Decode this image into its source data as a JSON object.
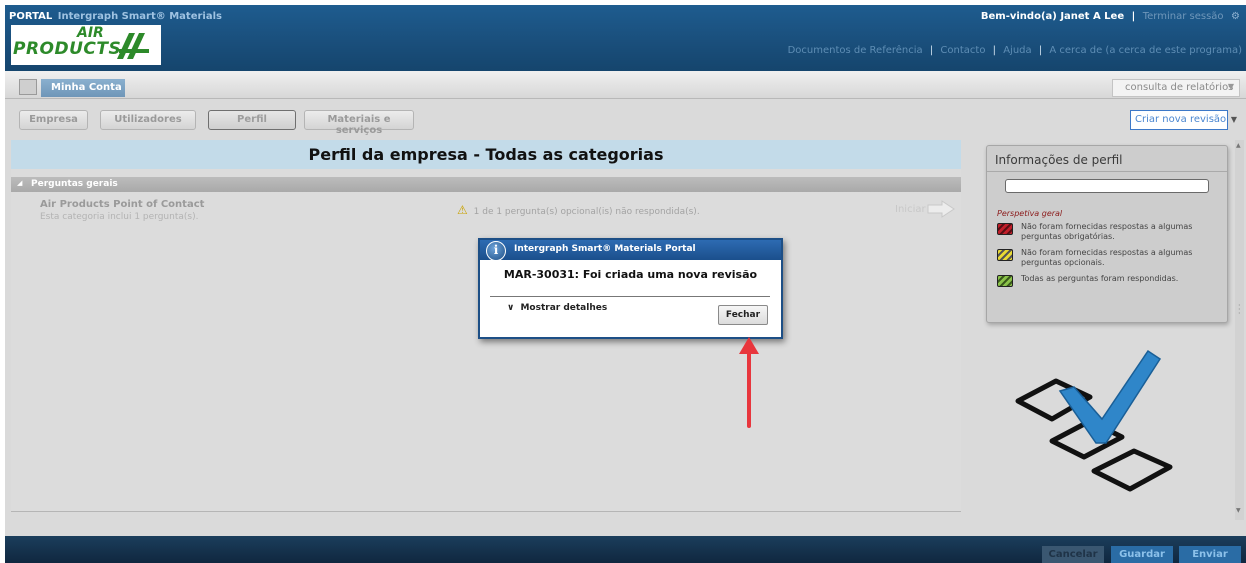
{
  "header": {
    "portal_label": "PORTAL",
    "app_name": "Intergraph Smart® Materials",
    "logo_air": "AIR",
    "logo_products": "PRODUCTS",
    "welcome": "Bem-vindo(a) Janet A Lee",
    "separator": "|",
    "logout": "Terminar sessão",
    "links": [
      "Documentos de Referência",
      "Contacto",
      "Ajuda",
      "A cerca de (a cerca de este programa)"
    ]
  },
  "tabstrip": {
    "account_tab": "Minha Conta",
    "reports_dropdown": "consulta de relatórios"
  },
  "subtabs": [
    {
      "label": "Empresa"
    },
    {
      "label": "Utilizadores"
    },
    {
      "label": "Perfil"
    },
    {
      "label": "Materiais e serviços"
    }
  ],
  "revision_dropdown": "Criar nova revisão",
  "main": {
    "title": "Perfil da empresa - Todas as categorias",
    "section": "Perguntas gerais",
    "category": {
      "name": "Air Products Point of Contact",
      "description": "Esta categoria inclui 1 pergunta(s).",
      "status": "1 de 1 pergunta(s) opcional(is) não respondida(s).",
      "action": "Iniciar"
    }
  },
  "profile_info": {
    "title": "Informações de perfil",
    "overview_label": "Perspetiva geral",
    "legend": [
      {
        "color": "red",
        "text": "Não foram fornecidas respostas a algumas perguntas obrigatórias."
      },
      {
        "color": "yellow",
        "text": "Não foram fornecidas respostas a algumas perguntas opcionais."
      },
      {
        "color": "green",
        "text": "Todas as perguntas foram respondidas."
      }
    ]
  },
  "footer": {
    "cancel": "Cancelar",
    "save": "Guardar",
    "send": "Enviar"
  },
  "dialog": {
    "title": "Intergraph Smart® Materials Portal",
    "message": "MAR-30031: Foi criada uma nova revisão",
    "details_toggle": "Mostrar detalhes",
    "close_button": "Fechar"
  },
  "colors": {
    "header_blue": "#1a4f7c",
    "title_bar": "#c3dbe9",
    "dialog_blue": "#1d4f86",
    "annotation_red": "#e8363d",
    "footer": "#10273f"
  }
}
